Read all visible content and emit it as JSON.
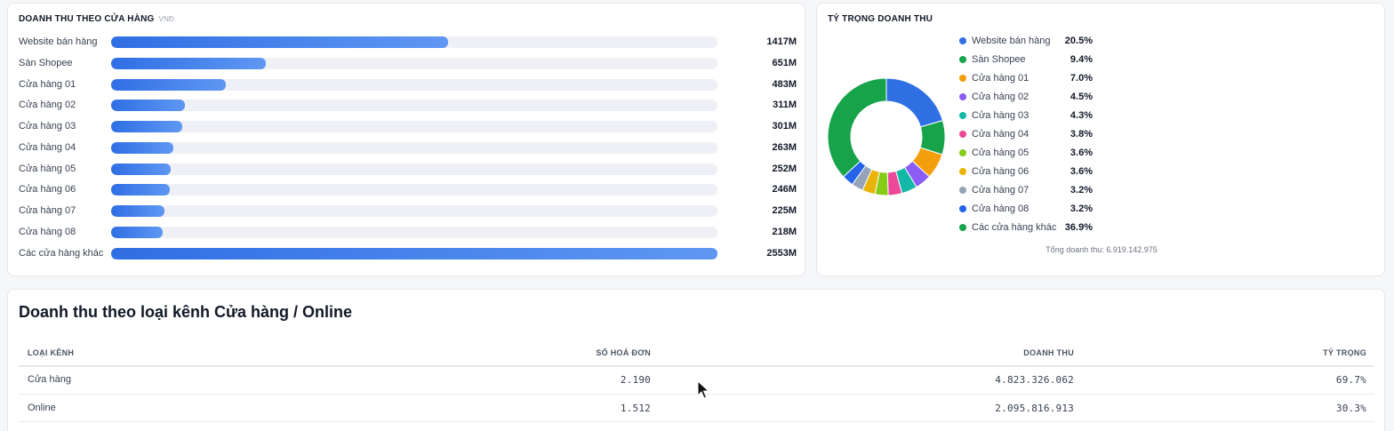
{
  "revenue_by_store": {
    "title": "DOANH THU THEO CỬA HÀNG",
    "unit": "VNĐ",
    "max": 2553,
    "items": [
      {
        "label": "Website bán hàng",
        "value": 1417,
        "display": "1417M"
      },
      {
        "label": "Sàn Shopee",
        "value": 651,
        "display": "651M"
      },
      {
        "label": "Cửa hàng 01",
        "value": 483,
        "display": "483M"
      },
      {
        "label": "Cửa hàng 02",
        "value": 311,
        "display": "311M"
      },
      {
        "label": "Cửa hàng 03",
        "value": 301,
        "display": "301M"
      },
      {
        "label": "Cửa hàng 04",
        "value": 263,
        "display": "263M"
      },
      {
        "label": "Cửa hàng 05",
        "value": 252,
        "display": "252M"
      },
      {
        "label": "Cửa hàng 06",
        "value": 246,
        "display": "246M"
      },
      {
        "label": "Cửa hàng 07",
        "value": 225,
        "display": "225M"
      },
      {
        "label": "Cửa hàng 08",
        "value": 218,
        "display": "218M"
      },
      {
        "label": "Các cửa hàng khác",
        "value": 2553,
        "display": "2553M"
      }
    ]
  },
  "revenue_share": {
    "title": "TỶ TRỌNG DOANH THU",
    "total_text": "Tổng doanh thu: 6.919.142.975",
    "items": [
      {
        "label": "Website bán hàng",
        "pct": 20.5,
        "display": "20.5%",
        "color": "#2f6fe4"
      },
      {
        "label": "Sàn Shopee",
        "pct": 9.4,
        "display": "9.4%",
        "color": "#16a34a"
      },
      {
        "label": "Cửa hàng 01",
        "pct": 7.0,
        "display": "7.0%",
        "color": "#f59e0b"
      },
      {
        "label": "Cửa hàng 02",
        "pct": 4.5,
        "display": "4.5%",
        "color": "#8b5cf6"
      },
      {
        "label": "Cửa hàng 03",
        "pct": 4.3,
        "display": "4.3%",
        "color": "#14b8a6"
      },
      {
        "label": "Cửa hàng 04",
        "pct": 3.8,
        "display": "3.8%",
        "color": "#ec4899"
      },
      {
        "label": "Cửa hàng 05",
        "pct": 3.6,
        "display": "3.6%",
        "color": "#84cc16"
      },
      {
        "label": "Cửa hàng 06",
        "pct": 3.6,
        "display": "3.6%",
        "color": "#eab308"
      },
      {
        "label": "Cửa hàng 07",
        "pct": 3.2,
        "display": "3.2%",
        "color": "#94a3b8"
      },
      {
        "label": "Cửa hàng 08",
        "pct": 3.2,
        "display": "3.2%",
        "color": "#2563eb"
      },
      {
        "label": "Các cửa hàng khác",
        "pct": 36.9,
        "display": "36.9%",
        "color": "#16a34a"
      }
    ]
  },
  "channel_table": {
    "title": "Doanh thu theo loại kênh Cửa hàng / Online",
    "headers": {
      "channel": "LOẠI KÊNH",
      "invoices": "SỐ HOÁ ĐƠN",
      "revenue": "DOANH THU",
      "share": "TỶ TRỌNG"
    },
    "rows": [
      {
        "channel": "Cửa hàng",
        "invoices": "2.190",
        "revenue": "4.823.326.062",
        "share": "69.7%"
      },
      {
        "channel": "Online",
        "invoices": "1.512",
        "revenue": "2.095.816.913",
        "share": "30.3%"
      }
    ]
  },
  "chart_data": [
    {
      "type": "bar",
      "title": "DOANH THU THEO CỬA HÀNG",
      "categories": [
        "Website bán hàng",
        "Sàn Shopee",
        "Cửa hàng 01",
        "Cửa hàng 02",
        "Cửa hàng 03",
        "Cửa hàng 04",
        "Cửa hàng 05",
        "Cửa hàng 06",
        "Cửa hàng 07",
        "Cửa hàng 08",
        "Các cửa hàng khác"
      ],
      "values": [
        1417,
        651,
        483,
        311,
        301,
        263,
        252,
        246,
        225,
        218,
        2553
      ],
      "orientation": "horizontal"
    },
    {
      "type": "pie",
      "title": "TỶ TRỌNG DOANH THU",
      "categories": [
        "Website bán hàng",
        "Sàn Shopee",
        "Cửa hàng 01",
        "Cửa hàng 02",
        "Cửa hàng 03",
        "Cửa hàng 04",
        "Cửa hàng 05",
        "Cửa hàng 06",
        "Cửa hàng 07",
        "Cửa hàng 08",
        "Các cửa hàng khác"
      ],
      "values": [
        20.5,
        9.4,
        7.0,
        4.5,
        4.3,
        3.8,
        3.6,
        3.6,
        3.2,
        3.2,
        36.9
      ],
      "donut": true,
      "legend": "right"
    }
  ]
}
